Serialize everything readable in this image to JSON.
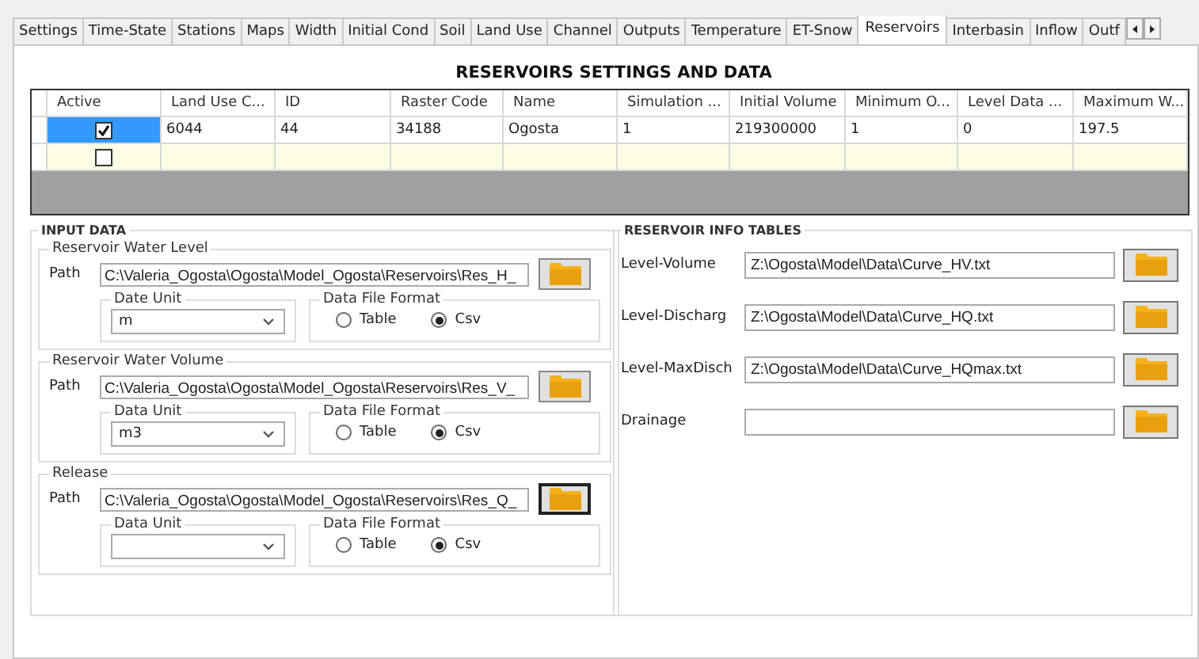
{
  "tabs": [
    {
      "label": "Settings",
      "selected": false
    },
    {
      "label": "Time-State",
      "selected": false
    },
    {
      "label": "Stations",
      "selected": false
    },
    {
      "label": "Maps",
      "selected": false
    },
    {
      "label": "Width",
      "selected": false
    },
    {
      "label": "Initial Cond",
      "selected": false
    },
    {
      "label": "Soil",
      "selected": false
    },
    {
      "label": "Land Use",
      "selected": false
    },
    {
      "label": "Channel",
      "selected": false
    },
    {
      "label": "Outputs",
      "selected": false
    },
    {
      "label": "Temperature",
      "selected": false
    },
    {
      "label": "ET-Snow",
      "selected": false
    },
    {
      "label": "Reservoirs",
      "selected": true
    },
    {
      "label": "Interbasin",
      "selected": false
    },
    {
      "label": "Inflow",
      "selected": false
    },
    {
      "label": "Outf",
      "selected": false
    }
  ],
  "title": "RESERVOIRS SETTINGS AND DATA",
  "grid": {
    "active_column": "Active",
    "columns": [
      "Land Use C...",
      "ID",
      "Raster Code",
      "Name",
      "Simulation ...",
      "Initial Volume",
      "Minimum O...",
      "Level Data ...",
      "Maximum W..."
    ],
    "rows": [
      {
        "kind": "data",
        "active": true,
        "focused": true,
        "cells": [
          "6044",
          "44",
          "34188",
          "Ogosta",
          "1",
          "219300000",
          "1",
          "0",
          "197.5"
        ]
      },
      {
        "kind": "new",
        "active": false,
        "focused": false,
        "cells": []
      }
    ]
  },
  "input_data": {
    "title": "INPUT DATA",
    "groups": [
      {
        "title": "Reservoir Water Level",
        "path_label": "Path",
        "path": "C:\\Valeria_Ogosta\\Ogosta\\Model_Ogosta\\Reservoirs\\Res_H_",
        "browse_focused": false,
        "unit_label": "Date Unit",
        "unit": "m",
        "format_label": "Data File Format",
        "formats": [
          {
            "label": "Table",
            "selected": false
          },
          {
            "label": "Csv",
            "selected": true
          }
        ]
      },
      {
        "title": "Reservoir Water Volume",
        "path_label": "Path",
        "path": "C:\\Valeria_Ogosta\\Ogosta\\Model_Ogosta\\Reservoirs\\Res_V_",
        "browse_focused": false,
        "unit_label": "Data Unit",
        "unit": "m3",
        "format_label": "Data File Format",
        "formats": [
          {
            "label": "Table",
            "selected": false
          },
          {
            "label": "Csv",
            "selected": true
          }
        ]
      },
      {
        "title": "Release",
        "path_label": "Path",
        "path": "C:\\Valeria_Ogosta\\Ogosta\\Model_Ogosta\\Reservoirs\\Res_Q_",
        "browse_focused": true,
        "unit_label": "Data Unit",
        "format_label": "Data File Format",
        "formats": [
          {
            "label": "Table",
            "selected": false
          },
          {
            "label": "Csv",
            "selected": true
          }
        ]
      }
    ]
  },
  "info_tables": {
    "title": "RESERVOIR INFO TABLES",
    "rows": [
      {
        "label": "Level-Volume",
        "value": "Z:\\Ogosta\\Model\\Data\\Curve_HV.txt"
      },
      {
        "label": "Level-Discharg",
        "value": "Z:\\Ogosta\\Model\\Data\\Curve_HQ.txt"
      },
      {
        "label": "Level-MaxDisch",
        "value": "Z:\\Ogosta\\Model\\Data\\Curve_HQmax.txt"
      },
      {
        "label": "Drainage"
      }
    ]
  }
}
